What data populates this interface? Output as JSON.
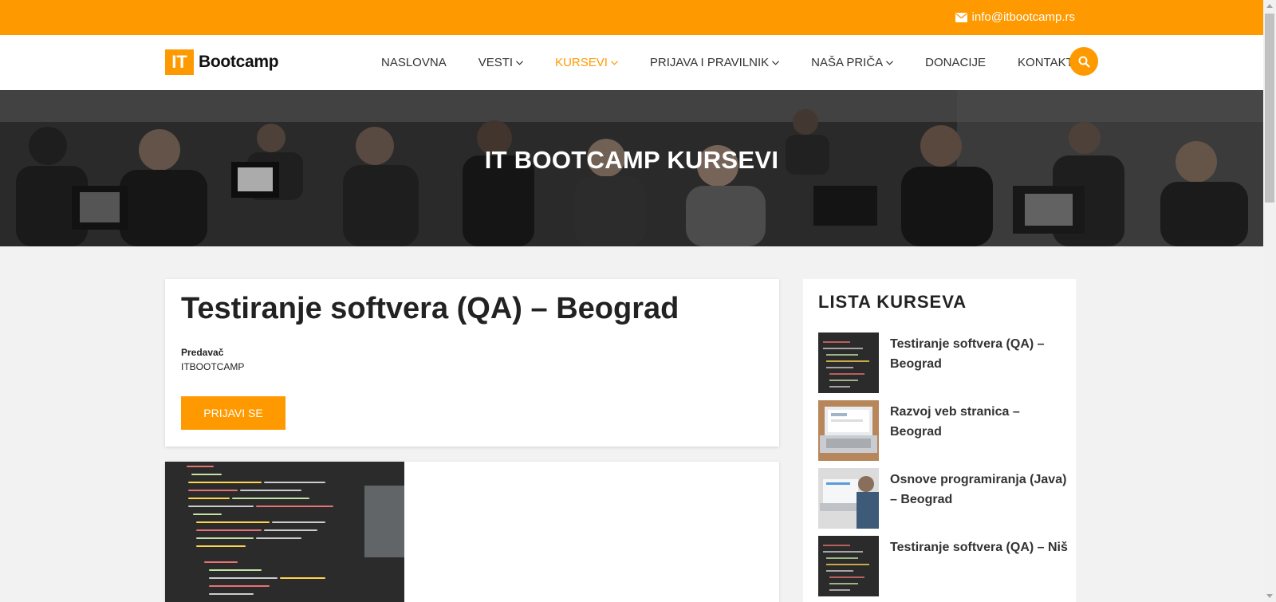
{
  "topbar": {
    "email": "info@itbootcamp.rs"
  },
  "logo": {
    "mark": "IT",
    "word": "Bootcamp"
  },
  "nav": {
    "items": [
      {
        "label": "NASLOVNA",
        "dropdown": false
      },
      {
        "label": "VESTI",
        "dropdown": true
      },
      {
        "label": "KURSEVI",
        "dropdown": true,
        "active": true
      },
      {
        "label": "PRIJAVA I PRAVILNIK",
        "dropdown": true
      },
      {
        "label": "NAŠA PRIČA",
        "dropdown": true
      },
      {
        "label": "DONACIJE",
        "dropdown": false
      },
      {
        "label": "KONTAKT",
        "dropdown": false
      }
    ],
    "search_icon": "search-icon"
  },
  "hero": {
    "title": "IT BOOTCAMP KURSEVI"
  },
  "course": {
    "title": "Testiranje softvera (QA) – Beograd",
    "instructor_label": "Predavač",
    "instructor_name": "ITBOOTCAMP",
    "apply_label": "PRIJAVI SE"
  },
  "sidebar": {
    "title": "LISTA KURSEVA",
    "items": [
      {
        "title": "Testiranje softvera (QA) – Beograd",
        "thumb": "code"
      },
      {
        "title": "Razvoj veb stranica – Beograd",
        "thumb": "laptop"
      },
      {
        "title": "Osnove programiranja (Java) – Beograd",
        "thumb": "laptop-desk"
      },
      {
        "title": "Testiranje softvera (QA) – Niš",
        "thumb": "code"
      }
    ]
  },
  "colors": {
    "accent": "#ff9900",
    "background": "#f2f2f2",
    "text": "#222222"
  }
}
